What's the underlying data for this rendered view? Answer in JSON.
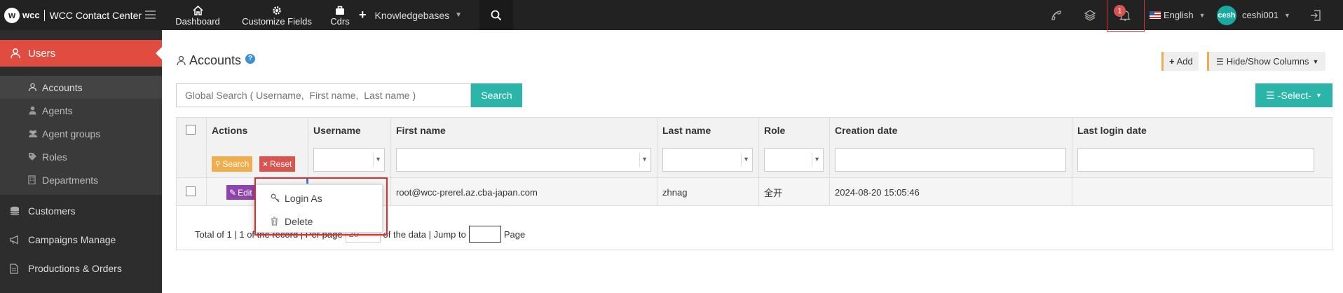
{
  "brand": {
    "logo": "w",
    "name": "wcc",
    "title": "WCC Contact Center"
  },
  "topnav": [
    {
      "label": "Dashboard",
      "icon": "home-icon"
    },
    {
      "label": "Customize Fields",
      "icon": "gear-icon"
    },
    {
      "label": "Cdrs",
      "icon": "briefcase-icon"
    }
  ],
  "knowledgebases": {
    "label": "Knowledgebases"
  },
  "notifications": {
    "count": "1"
  },
  "language": {
    "label": "English"
  },
  "user": {
    "avatar": "cesh",
    "name": "ceshi001"
  },
  "sidebar": {
    "active": "Users",
    "sub_items": [
      {
        "label": "Accounts"
      },
      {
        "label": "Agents"
      },
      {
        "label": "Agent groups"
      },
      {
        "label": "Roles"
      },
      {
        "label": "Departments"
      }
    ],
    "items": [
      {
        "label": "Customers"
      },
      {
        "label": "Campaigns Manage"
      },
      {
        "label": "Productions & Orders"
      }
    ]
  },
  "page": {
    "title": "Accounts",
    "help": "?",
    "add_label": "Add",
    "hide_show_label": "Hide/Show Columns",
    "search_placeholder": "Global Search ( Username,  First name,  Last name )",
    "search_label": "Search",
    "select_label": "-Select-"
  },
  "table": {
    "columns": [
      "Actions",
      "Username",
      "First name",
      "Last name",
      "Role",
      "Creation date",
      "Last login date"
    ],
    "filter_search": "Search",
    "filter_reset": "Reset",
    "rows": [
      {
        "edit": "Edit",
        "username": "",
        "first_name": "root@wcc-prerel.az.cba-japan.com",
        "last_name": "zhnag",
        "role": "全开",
        "creation_date": "2024-08-20 15:05:46",
        "last_login": ""
      }
    ]
  },
  "pager": {
    "total": "Total of 1 | 1 of the record | Per page",
    "per_page": "20",
    "of_data": "of the data | Jump to",
    "page": "Page"
  },
  "context_menu": {
    "items": [
      {
        "label": "Login As",
        "icon": "key-icon"
      },
      {
        "label": "Delete",
        "icon": "trash-icon"
      }
    ]
  }
}
